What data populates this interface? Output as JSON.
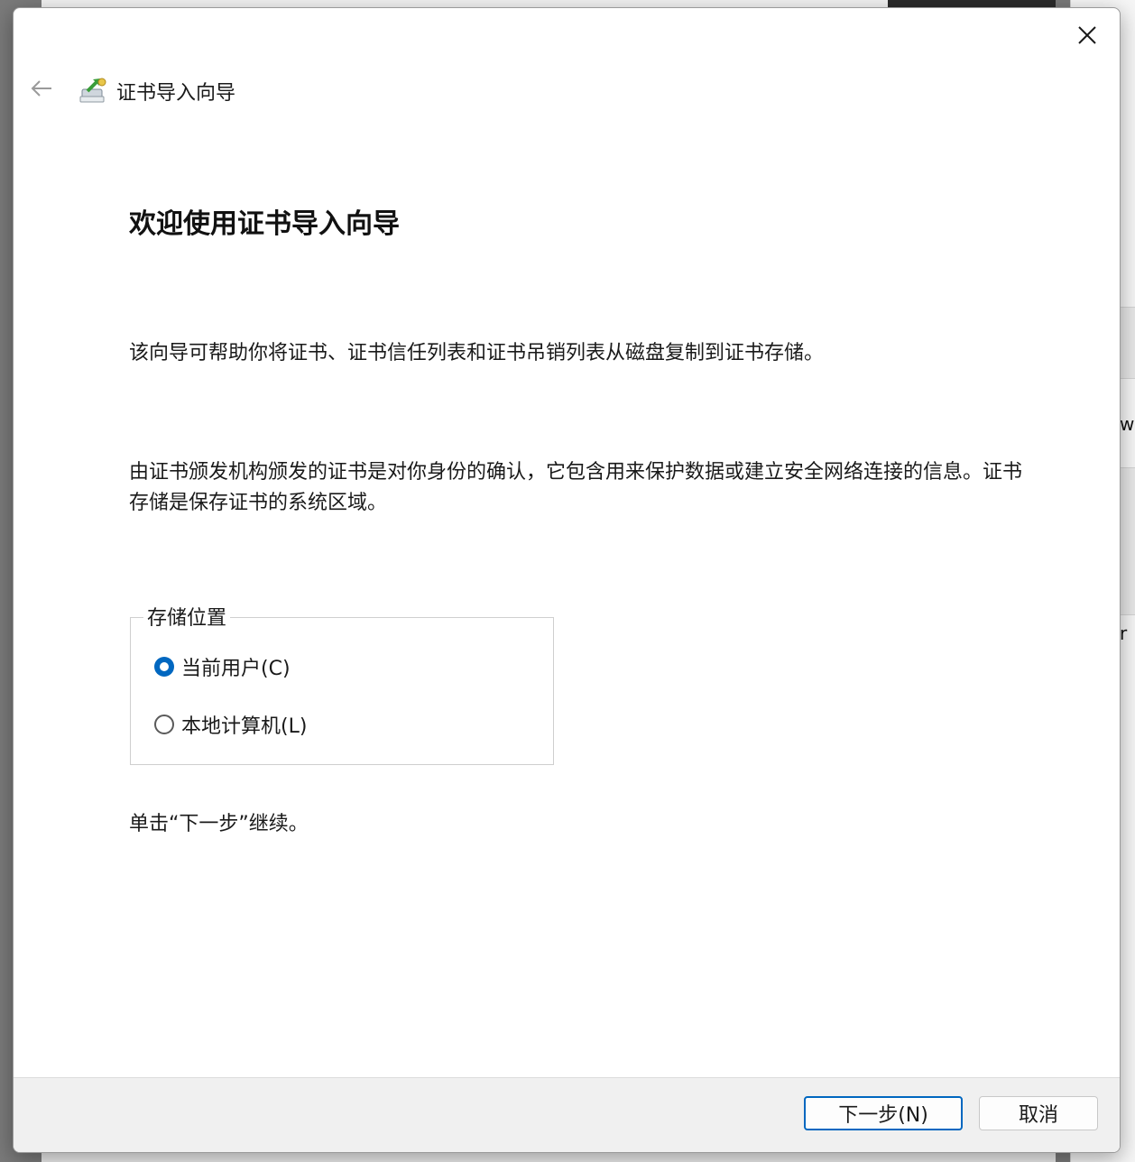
{
  "background": {
    "right_fragments": [
      "w",
      "r"
    ]
  },
  "wizard": {
    "title": "证书导入向导",
    "heading": "欢迎使用证书导入向导",
    "paragraph1": "该向导可帮助你将证书、证书信任列表和证书吊销列表从磁盘复制到证书存储。",
    "paragraph2": "由证书颁发机构颁发的证书是对你身份的确认，它包含用来保护数据或建立安全网络连接的信息。证书存储是保存证书的系统区域。",
    "store_location": {
      "legend": "存储位置",
      "options": [
        {
          "label": "当前用户(C)",
          "checked": true
        },
        {
          "label": "本地计算机(L)",
          "checked": false
        }
      ]
    },
    "continue_hint": "单击“下一步”继续。"
  },
  "buttons": {
    "next_label": "下一步(N)",
    "cancel_label": "取消"
  },
  "colors": {
    "accent": "#0067c0"
  }
}
